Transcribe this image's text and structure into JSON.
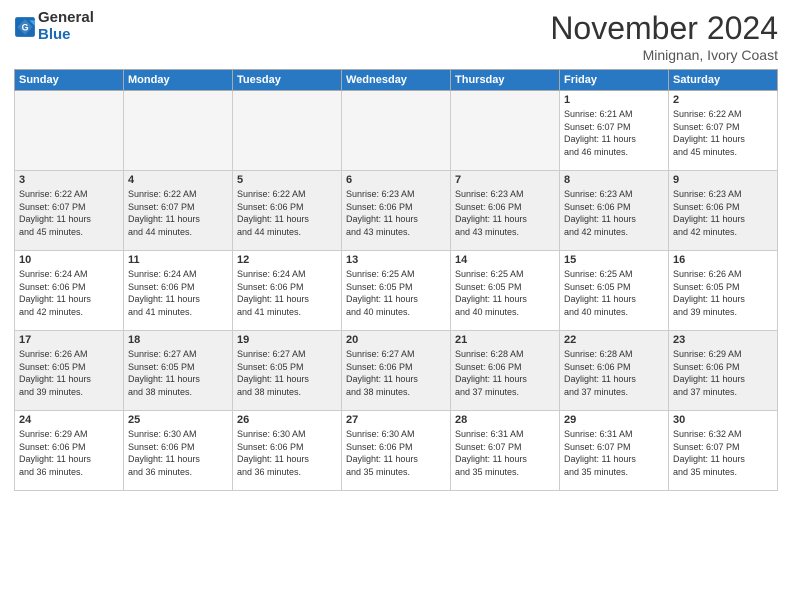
{
  "logo": {
    "line1": "General",
    "line2": "Blue"
  },
  "title": "November 2024",
  "subtitle": "Minignan, Ivory Coast",
  "weekdays": [
    "Sunday",
    "Monday",
    "Tuesday",
    "Wednesday",
    "Thursday",
    "Friday",
    "Saturday"
  ],
  "weeks": [
    [
      {
        "day": "",
        "info": ""
      },
      {
        "day": "",
        "info": ""
      },
      {
        "day": "",
        "info": ""
      },
      {
        "day": "",
        "info": ""
      },
      {
        "day": "",
        "info": ""
      },
      {
        "day": "1",
        "info": "Sunrise: 6:21 AM\nSunset: 6:07 PM\nDaylight: 11 hours\nand 46 minutes."
      },
      {
        "day": "2",
        "info": "Sunrise: 6:22 AM\nSunset: 6:07 PM\nDaylight: 11 hours\nand 45 minutes."
      }
    ],
    [
      {
        "day": "3",
        "info": "Sunrise: 6:22 AM\nSunset: 6:07 PM\nDaylight: 11 hours\nand 45 minutes."
      },
      {
        "day": "4",
        "info": "Sunrise: 6:22 AM\nSunset: 6:07 PM\nDaylight: 11 hours\nand 44 minutes."
      },
      {
        "day": "5",
        "info": "Sunrise: 6:22 AM\nSunset: 6:06 PM\nDaylight: 11 hours\nand 44 minutes."
      },
      {
        "day": "6",
        "info": "Sunrise: 6:23 AM\nSunset: 6:06 PM\nDaylight: 11 hours\nand 43 minutes."
      },
      {
        "day": "7",
        "info": "Sunrise: 6:23 AM\nSunset: 6:06 PM\nDaylight: 11 hours\nand 43 minutes."
      },
      {
        "day": "8",
        "info": "Sunrise: 6:23 AM\nSunset: 6:06 PM\nDaylight: 11 hours\nand 42 minutes."
      },
      {
        "day": "9",
        "info": "Sunrise: 6:23 AM\nSunset: 6:06 PM\nDaylight: 11 hours\nand 42 minutes."
      }
    ],
    [
      {
        "day": "10",
        "info": "Sunrise: 6:24 AM\nSunset: 6:06 PM\nDaylight: 11 hours\nand 42 minutes."
      },
      {
        "day": "11",
        "info": "Sunrise: 6:24 AM\nSunset: 6:06 PM\nDaylight: 11 hours\nand 41 minutes."
      },
      {
        "day": "12",
        "info": "Sunrise: 6:24 AM\nSunset: 6:06 PM\nDaylight: 11 hours\nand 41 minutes."
      },
      {
        "day": "13",
        "info": "Sunrise: 6:25 AM\nSunset: 6:05 PM\nDaylight: 11 hours\nand 40 minutes."
      },
      {
        "day": "14",
        "info": "Sunrise: 6:25 AM\nSunset: 6:05 PM\nDaylight: 11 hours\nand 40 minutes."
      },
      {
        "day": "15",
        "info": "Sunrise: 6:25 AM\nSunset: 6:05 PM\nDaylight: 11 hours\nand 40 minutes."
      },
      {
        "day": "16",
        "info": "Sunrise: 6:26 AM\nSunset: 6:05 PM\nDaylight: 11 hours\nand 39 minutes."
      }
    ],
    [
      {
        "day": "17",
        "info": "Sunrise: 6:26 AM\nSunset: 6:05 PM\nDaylight: 11 hours\nand 39 minutes."
      },
      {
        "day": "18",
        "info": "Sunrise: 6:27 AM\nSunset: 6:05 PM\nDaylight: 11 hours\nand 38 minutes."
      },
      {
        "day": "19",
        "info": "Sunrise: 6:27 AM\nSunset: 6:05 PM\nDaylight: 11 hours\nand 38 minutes."
      },
      {
        "day": "20",
        "info": "Sunrise: 6:27 AM\nSunset: 6:06 PM\nDaylight: 11 hours\nand 38 minutes."
      },
      {
        "day": "21",
        "info": "Sunrise: 6:28 AM\nSunset: 6:06 PM\nDaylight: 11 hours\nand 37 minutes."
      },
      {
        "day": "22",
        "info": "Sunrise: 6:28 AM\nSunset: 6:06 PM\nDaylight: 11 hours\nand 37 minutes."
      },
      {
        "day": "23",
        "info": "Sunrise: 6:29 AM\nSunset: 6:06 PM\nDaylight: 11 hours\nand 37 minutes."
      }
    ],
    [
      {
        "day": "24",
        "info": "Sunrise: 6:29 AM\nSunset: 6:06 PM\nDaylight: 11 hours\nand 36 minutes."
      },
      {
        "day": "25",
        "info": "Sunrise: 6:30 AM\nSunset: 6:06 PM\nDaylight: 11 hours\nand 36 minutes."
      },
      {
        "day": "26",
        "info": "Sunrise: 6:30 AM\nSunset: 6:06 PM\nDaylight: 11 hours\nand 36 minutes."
      },
      {
        "day": "27",
        "info": "Sunrise: 6:30 AM\nSunset: 6:06 PM\nDaylight: 11 hours\nand 35 minutes."
      },
      {
        "day": "28",
        "info": "Sunrise: 6:31 AM\nSunset: 6:07 PM\nDaylight: 11 hours\nand 35 minutes."
      },
      {
        "day": "29",
        "info": "Sunrise: 6:31 AM\nSunset: 6:07 PM\nDaylight: 11 hours\nand 35 minutes."
      },
      {
        "day": "30",
        "info": "Sunrise: 6:32 AM\nSunset: 6:07 PM\nDaylight: 11 hours\nand 35 minutes."
      }
    ]
  ]
}
